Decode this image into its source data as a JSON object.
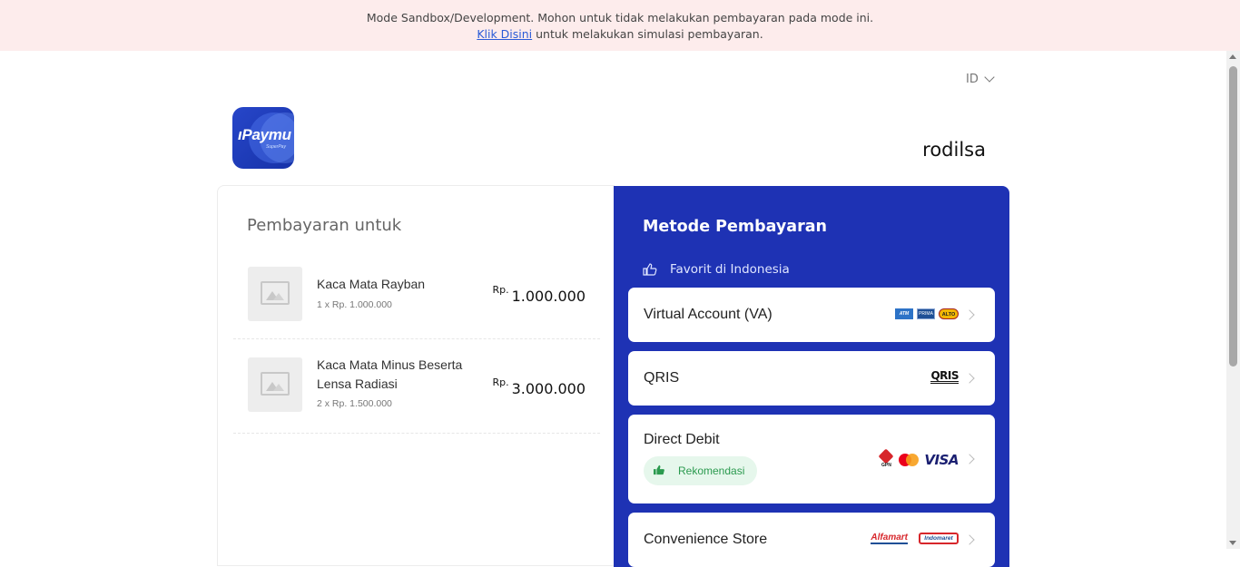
{
  "banner": {
    "line1": "Mode Sandbox/Development. Mohon untuk tidak melakukan pembayaran pada mode ini.",
    "link_text": "Klik Disini",
    "line2_rest": " untuk melakukan simulasi pembayaran."
  },
  "header": {
    "language": "ID",
    "logo_text": "ıPaymu",
    "logo_sub": "SuperPay",
    "merchant_name": "rodilsa"
  },
  "order": {
    "title": "Pembayaran untuk",
    "items": [
      {
        "name": "Kaca Mata Rayban",
        "qty": "1 x Rp. 1.000.000",
        "currency": "Rp.",
        "total": "1.000.000"
      },
      {
        "name": "Kaca Mata Minus Beserta Lensa Radiasi",
        "qty": "2 x Rp. 1.500.000",
        "currency": "Rp.",
        "total": "3.000.000"
      }
    ]
  },
  "payment": {
    "title": "Metode Pembayaran",
    "favorite_label": "Favorit di Indonesia",
    "methods": [
      {
        "label": "Virtual Account (VA)",
        "logos": [
          "ATM BERSAMA",
          "PRIMA",
          "ALTO"
        ]
      },
      {
        "label": "QRIS",
        "logos": [
          "QRIS"
        ]
      },
      {
        "label": "Direct Debit",
        "badge": "Rekomendasi",
        "logos": [
          "GPN",
          "MasterCard",
          "VISA"
        ]
      },
      {
        "label": "Convenience Store",
        "logos": [
          "Alfamart",
          "Indomaret"
        ]
      }
    ]
  },
  "colors": {
    "banner_bg": "#fdecec",
    "panel_blue": "#1e32b4",
    "link": "#2a5bd7",
    "badge_green": "#2b9a4f"
  }
}
